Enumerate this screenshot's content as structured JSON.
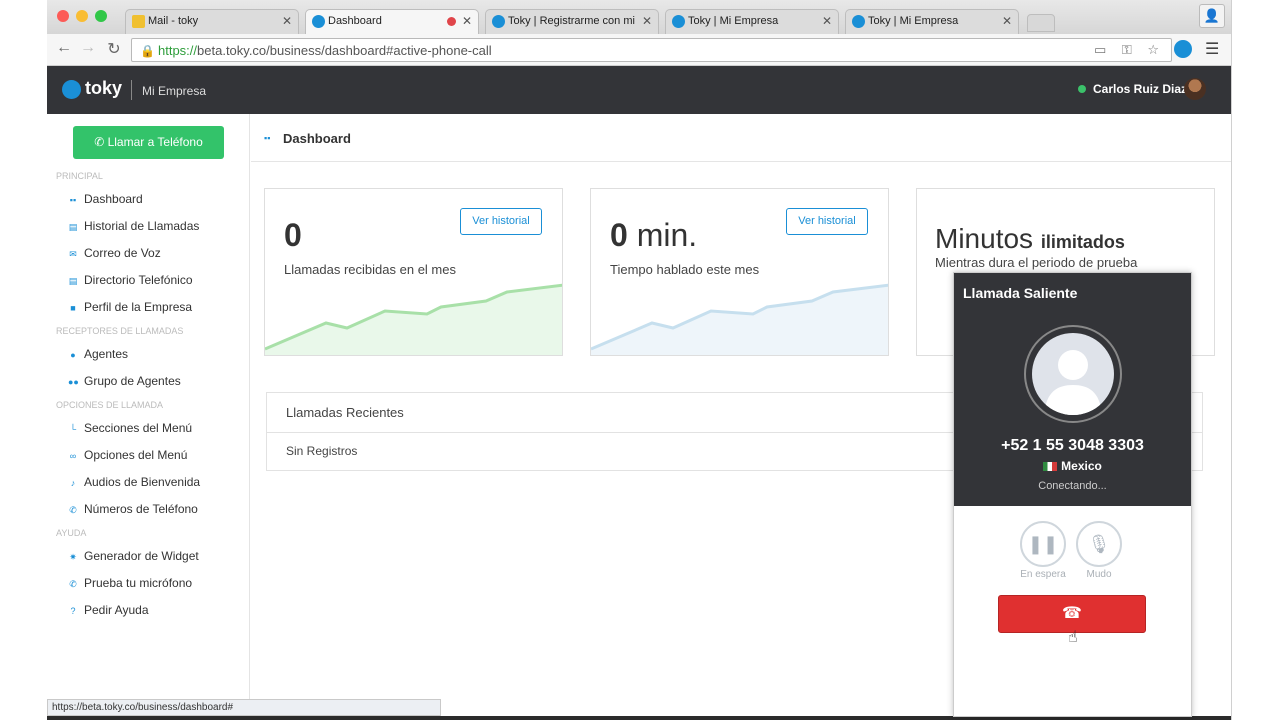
{
  "browser": {
    "tabs": [
      {
        "label": "Mail - toky"
      },
      {
        "label": "Dashboard"
      },
      {
        "label": "Toky | Registrarme con mi"
      },
      {
        "label": "Toky | Mi Empresa"
      },
      {
        "label": "Toky | Mi Empresa"
      }
    ],
    "url_scheme": "https://",
    "url_rest": "beta.toky.co/business/dashboard#active-phone-call",
    "status_url": "https://beta.toky.co/business/dashboard#"
  },
  "header": {
    "logo": "toky",
    "company": "Mi Empresa",
    "user": "Carlos Ruiz Diaz"
  },
  "sidebar": {
    "call_button": "Llamar a Teléfono",
    "sections": [
      {
        "title": "PRINCIPAL",
        "items": [
          "Dashboard",
          "Historial de Llamadas",
          "Correo de Voz",
          "Directorio Telefónico",
          "Perfil de la Empresa"
        ]
      },
      {
        "title": "RECEPTORES DE LLAMADAS",
        "items": [
          "Agentes",
          "Grupo de Agentes"
        ]
      },
      {
        "title": "OPCIONES DE LLAMADA",
        "items": [
          "Secciones del Menú",
          "Opciones del Menú",
          "Audios de Bienvenida",
          "Números de Teléfono"
        ]
      },
      {
        "title": "AYUDA",
        "items": [
          "Generador de Widget",
          "Prueba tu micrófono",
          "Pedir Ayuda"
        ]
      }
    ]
  },
  "main": {
    "page_title": "Dashboard",
    "cards": [
      {
        "value": "0",
        "unit": "",
        "label": "Llamadas recibidas en el mes",
        "button": "Ver historial"
      },
      {
        "value": "0",
        "unit": "min.",
        "label": "Tiempo hablado este mes",
        "button": "Ver historial"
      },
      {
        "title": "Minutos",
        "title_bold": "ilimitados",
        "label": "Mientras dura el periodo de prueba"
      }
    ],
    "recent": {
      "title": "Llamadas Recientes",
      "empty": "Sin Registros"
    }
  },
  "call_widget": {
    "title": "Llamada Saliente",
    "number": "+52 1 55 3048 3303",
    "country": "Mexico",
    "status": "Conectando...",
    "hold_label": "En espera",
    "mute_label": "Mudo"
  },
  "colors": {
    "accent": "#1a8fd6",
    "green": "#33c36a",
    "hangup": "#e03030",
    "header_bg": "#333438"
  }
}
